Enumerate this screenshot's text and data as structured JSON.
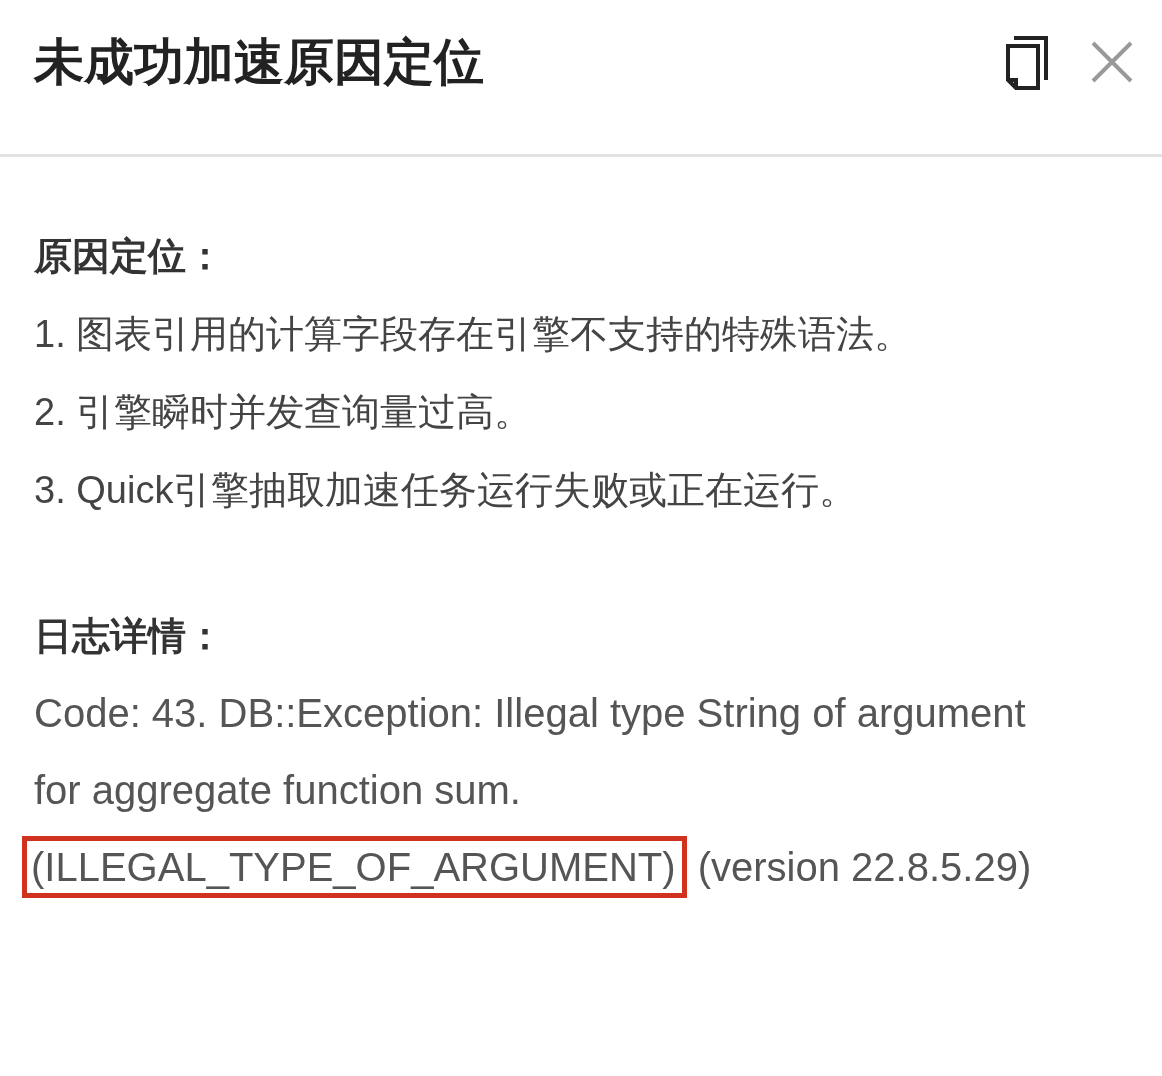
{
  "dialog": {
    "title": "未成功加速原因定位"
  },
  "cause": {
    "heading": "原因定位：",
    "items": [
      "1. 图表引用的计算字段存在引擎不支持的特殊语法。",
      "2. 引擎瞬时并发查询量过高。",
      "3. Quick引擎抽取加速任务运行失败或正在运行。"
    ]
  },
  "log": {
    "heading": "日志详情：",
    "text": "Code: 43. DB::Exception: Illegal type String of argument for aggregate function sum.",
    "highlight": "(ILLEGAL_TYPE_OF_ARGUMENT)",
    "suffix": "(version 22.8.5.29)"
  }
}
